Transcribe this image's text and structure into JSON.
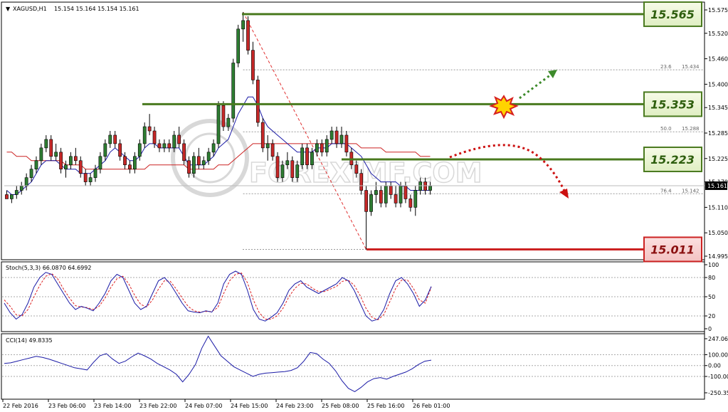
{
  "header": {
    "symbol_text": "XAGUSD,H1",
    "ohlc_text": "15.154 15.164 15.154 15.161"
  },
  "watermark": "FOREXIMF.COM",
  "levels": [
    {
      "label": "15.565",
      "value": 15.565,
      "kind": "resistance"
    },
    {
      "label": "15.353",
      "value": 15.353,
      "kind": "resistance"
    },
    {
      "label": "15.223",
      "value": 15.223,
      "kind": "resistance"
    },
    {
      "label": "15.011",
      "value": 15.011,
      "kind": "support"
    }
  ],
  "fib_levels": [
    {
      "ratio": "23.6",
      "price": "15.434",
      "value": 15.434
    },
    {
      "ratio": "50.0",
      "price": "15.288",
      "value": 15.288
    },
    {
      "ratio": "76.4",
      "price": "15.142",
      "value": 15.142
    }
  ],
  "current_price": "15.161",
  "colors": {
    "bull": "#2e7d32",
    "bear": "#c62828",
    "ma_fast": "#1a1aa6",
    "ma_slow": "#cc2222",
    "resistance": "#4a7a1f",
    "support": "#cc2222",
    "stoch_main": "#1a1aa6",
    "stoch_signal": "#dd2222",
    "cci": "#1a1aa6"
  },
  "chart_data": [
    {
      "type": "candlestick",
      "title": "XAGUSD,H1",
      "ylim": [
        14.995,
        15.585
      ],
      "yticks": [
        "15.575",
        "15.520",
        "15.460",
        "15.400",
        "15.345",
        "15.285",
        "15.225",
        "15.170",
        "15.110",
        "15.050",
        "14.995"
      ],
      "xlabels": [
        "22 Feb 2016",
        "23 Feb 06:00",
        "23 Feb 14:00",
        "23 Feb 22:00",
        "24 Feb 07:00",
        "24 Feb 15:00",
        "24 Feb 23:00",
        "25 Feb 08:00",
        "25 Feb 16:00",
        "26 Feb 01:00"
      ],
      "ohlc": [
        [
          15.14,
          15.15,
          15.13,
          15.13
        ],
        [
          15.13,
          15.14,
          15.12,
          15.14
        ],
        [
          15.14,
          15.16,
          15.13,
          15.15
        ],
        [
          15.15,
          15.17,
          15.14,
          15.16
        ],
        [
          15.16,
          15.19,
          15.15,
          15.18
        ],
        [
          15.18,
          15.21,
          15.17,
          15.2
        ],
        [
          15.2,
          15.23,
          15.19,
          15.22
        ],
        [
          15.22,
          15.26,
          15.21,
          15.25
        ],
        [
          15.25,
          15.28,
          15.24,
          15.27
        ],
        [
          15.27,
          15.28,
          15.22,
          15.23
        ],
        [
          15.23,
          15.26,
          15.22,
          15.24
        ],
        [
          15.24,
          15.25,
          15.19,
          15.2
        ],
        [
          15.2,
          15.22,
          15.18,
          15.21
        ],
        [
          15.21,
          15.24,
          15.2,
          15.23
        ],
        [
          15.23,
          15.25,
          15.21,
          15.22
        ],
        [
          15.22,
          15.23,
          15.18,
          15.19
        ],
        [
          15.19,
          15.2,
          15.16,
          15.17
        ],
        [
          15.17,
          15.19,
          15.16,
          15.18
        ],
        [
          15.18,
          15.21,
          15.17,
          15.2
        ],
        [
          15.2,
          15.24,
          15.19,
          15.23
        ],
        [
          15.23,
          15.27,
          15.22,
          15.26
        ],
        [
          15.26,
          15.29,
          15.25,
          15.28
        ],
        [
          15.28,
          15.29,
          15.25,
          15.26
        ],
        [
          15.26,
          15.27,
          15.22,
          15.23
        ],
        [
          15.23,
          15.24,
          15.2,
          15.21
        ],
        [
          15.21,
          15.22,
          15.19,
          15.2
        ],
        [
          15.2,
          15.24,
          15.19,
          15.23
        ],
        [
          15.23,
          15.27,
          15.22,
          15.26
        ],
        [
          15.26,
          15.31,
          15.25,
          15.3
        ],
        [
          15.3,
          15.33,
          15.28,
          15.29
        ],
        [
          15.29,
          15.3,
          15.25,
          15.26
        ],
        [
          15.26,
          15.27,
          15.24,
          15.25
        ],
        [
          15.25,
          15.27,
          15.24,
          15.26
        ],
        [
          15.26,
          15.27,
          15.24,
          15.25
        ],
        [
          15.25,
          15.29,
          15.24,
          15.28
        ],
        [
          15.28,
          15.3,
          15.25,
          15.26
        ],
        [
          15.26,
          15.27,
          15.21,
          15.22
        ],
        [
          15.22,
          15.23,
          15.18,
          15.19
        ],
        [
          15.19,
          15.24,
          15.18,
          15.23
        ],
        [
          15.23,
          15.25,
          15.2,
          15.21
        ],
        [
          15.21,
          15.23,
          15.2,
          15.22
        ],
        [
          15.22,
          15.25,
          15.21,
          15.24
        ],
        [
          15.24,
          15.27,
          15.23,
          15.26
        ],
        [
          15.26,
          15.36,
          15.25,
          15.35
        ],
        [
          15.35,
          15.36,
          15.29,
          15.3
        ],
        [
          15.3,
          15.33,
          15.29,
          15.32
        ],
        [
          15.32,
          15.46,
          15.31,
          15.45
        ],
        [
          15.45,
          15.54,
          15.44,
          15.53
        ],
        [
          15.53,
          15.57,
          15.5,
          15.55
        ],
        [
          15.55,
          15.56,
          15.47,
          15.48
        ],
        [
          15.48,
          15.5,
          15.4,
          15.41
        ],
        [
          15.41,
          15.42,
          15.3,
          15.31
        ],
        [
          15.31,
          15.32,
          15.24,
          15.25
        ],
        [
          15.25,
          15.28,
          15.22,
          15.26
        ],
        [
          15.26,
          15.27,
          15.22,
          15.23
        ],
        [
          15.23,
          15.24,
          15.17,
          15.18
        ],
        [
          15.18,
          15.22,
          15.17,
          15.21
        ],
        [
          15.21,
          15.24,
          15.2,
          15.22
        ],
        [
          15.22,
          15.23,
          15.17,
          15.18
        ],
        [
          15.18,
          15.22,
          15.17,
          15.21
        ],
        [
          15.21,
          15.26,
          15.2,
          15.25
        ],
        [
          15.25,
          15.26,
          15.2,
          15.21
        ],
        [
          15.21,
          15.25,
          15.2,
          15.24
        ],
        [
          15.24,
          15.27,
          15.23,
          15.26
        ],
        [
          15.26,
          15.27,
          15.23,
          15.24
        ],
        [
          15.24,
          15.28,
          15.23,
          15.27
        ],
        [
          15.27,
          15.3,
          15.26,
          15.29
        ],
        [
          15.29,
          15.3,
          15.25,
          15.26
        ],
        [
          15.26,
          15.3,
          15.25,
          15.28
        ],
        [
          15.28,
          15.29,
          15.23,
          15.24
        ],
        [
          15.24,
          15.25,
          15.2,
          15.21
        ],
        [
          15.21,
          15.22,
          15.18,
          15.19
        ],
        [
          15.19,
          15.2,
          15.14,
          15.15
        ],
        [
          15.15,
          15.16,
          15.011,
          15.1
        ],
        [
          15.1,
          15.15,
          15.09,
          15.14
        ],
        [
          15.14,
          15.17,
          15.12,
          15.15
        ],
        [
          15.15,
          15.16,
          15.11,
          15.12
        ],
        [
          15.12,
          15.17,
          15.11,
          15.16
        ],
        [
          15.16,
          15.17,
          15.13,
          15.14
        ],
        [
          15.14,
          15.16,
          15.11,
          15.12
        ],
        [
          15.12,
          15.17,
          15.11,
          15.16
        ],
        [
          15.16,
          15.17,
          15.12,
          15.13
        ],
        [
          15.13,
          15.14,
          15.1,
          15.11
        ],
        [
          15.11,
          15.16,
          15.09,
          15.15
        ],
        [
          15.15,
          15.18,
          15.14,
          15.17
        ],
        [
          15.17,
          15.18,
          15.14,
          15.15
        ],
        [
          15.15,
          15.17,
          15.14,
          15.16
        ]
      ],
      "ma_fast": [
        15.15,
        15.14,
        15.14,
        15.15,
        15.16,
        15.17,
        15.19,
        15.21,
        15.22,
        15.22,
        15.22,
        15.21,
        15.2,
        15.2,
        15.2,
        15.19,
        15.19,
        15.19,
        15.2,
        15.21,
        15.22,
        15.24,
        15.25,
        15.24,
        15.23,
        15.22,
        15.22,
        15.23,
        15.25,
        15.26,
        15.26,
        15.25,
        15.25,
        15.25,
        15.25,
        15.25,
        15.23,
        15.21,
        15.21,
        15.21,
        15.21,
        15.22,
        15.23,
        15.25,
        15.26,
        15.27,
        15.3,
        15.33,
        15.35,
        15.37,
        15.37,
        15.35,
        15.32,
        15.3,
        15.29,
        15.28,
        15.27,
        15.26,
        15.25,
        15.24,
        15.24,
        15.24,
        15.24,
        15.25,
        15.25,
        15.25,
        15.26,
        15.26,
        15.26,
        15.26,
        15.25,
        15.24,
        15.23,
        15.21,
        15.19,
        15.18,
        15.17,
        15.17,
        15.17,
        15.17,
        15.16,
        15.16,
        15.15,
        15.15,
        15.15,
        15.15,
        15.15
      ],
      "ma_slow": [
        15.24,
        15.24,
        15.23,
        15.23,
        15.23,
        15.22,
        15.22,
        15.22,
        15.22,
        15.22,
        15.22,
        15.22,
        15.21,
        15.21,
        15.21,
        15.21,
        15.2,
        15.2,
        15.2,
        15.2,
        15.2,
        15.2,
        15.2,
        15.2,
        15.2,
        15.2,
        15.2,
        15.2,
        15.2,
        15.21,
        15.21,
        15.21,
        15.21,
        15.21,
        15.21,
        15.21,
        15.21,
        15.2,
        15.2,
        15.2,
        15.2,
        15.2,
        15.2,
        15.21,
        15.21,
        15.21,
        15.22,
        15.23,
        15.24,
        15.25,
        15.26,
        15.26,
        15.26,
        15.26,
        15.26,
        15.26,
        15.26,
        15.26,
        15.26,
        15.26,
        15.26,
        15.26,
        15.26,
        15.26,
        15.26,
        15.26,
        15.26,
        15.26,
        15.26,
        15.26,
        15.26,
        15.26,
        15.25,
        15.25,
        15.25,
        15.25,
        15.25,
        15.24,
        15.24,
        15.24,
        15.24,
        15.24,
        15.24,
        15.24,
        15.23,
        15.23,
        15.23
      ]
    },
    {
      "type": "line",
      "title": "Stoch(5,3,3) 66.0870 64.6992",
      "ylim": [
        0,
        100
      ],
      "yticks": [
        "100",
        "80",
        "50",
        "20",
        "0"
      ],
      "series": [
        {
          "name": "main",
          "values": [
            40,
            25,
            15,
            22,
            40,
            65,
            80,
            88,
            85,
            70,
            55,
            40,
            30,
            35,
            32,
            28,
            40,
            55,
            75,
            85,
            80,
            60,
            40,
            30,
            35,
            55,
            75,
            80,
            70,
            55,
            40,
            28,
            26,
            25,
            28,
            26,
            40,
            70,
            85,
            90,
            85,
            60,
            30,
            15,
            12,
            18,
            25,
            40,
            60,
            70,
            75,
            65,
            60,
            55,
            60,
            65,
            70,
            80,
            75,
            60,
            40,
            20,
            12,
            15,
            30,
            55,
            75,
            80,
            70,
            55,
            35,
            45,
            66
          ]
        },
        {
          "name": "signal",
          "values": [
            45,
            35,
            22,
            20,
            30,
            50,
            68,
            82,
            86,
            78,
            62,
            48,
            36,
            34,
            33,
            30,
            35,
            48,
            65,
            78,
            82,
            70,
            52,
            38,
            34,
            45,
            62,
            75,
            74,
            62,
            48,
            35,
            28,
            26,
            27,
            27,
            33,
            55,
            75,
            85,
            87,
            72,
            45,
            25,
            15,
            15,
            20,
            32,
            50,
            63,
            71,
            70,
            63,
            58,
            58,
            62,
            66,
            74,
            76,
            68,
            52,
            32,
            18,
            14,
            22,
            42,
            63,
            76,
            76,
            63,
            45,
            40,
            64.7
          ]
        }
      ]
    },
    {
      "type": "line",
      "title": "CCI(14) 49.8335",
      "ylim": [
        -250.35,
        247.065
      ],
      "yticks": [
        "247.065",
        "100.00",
        "0.00",
        "-100.00",
        "-250.35"
      ],
      "series": [
        {
          "name": "CCI",
          "values": [
            20,
            25,
            40,
            55,
            70,
            85,
            75,
            60,
            40,
            20,
            0,
            -20,
            -30,
            -40,
            30,
            90,
            110,
            60,
            20,
            40,
            80,
            115,
            90,
            60,
            20,
            -10,
            -40,
            -80,
            -150,
            -80,
            10,
            160,
            270,
            180,
            90,
            40,
            -10,
            -40,
            -70,
            -100,
            -80,
            -70,
            -65,
            -60,
            -55,
            -45,
            -20,
            40,
            120,
            110,
            60,
            20,
            -50,
            -140,
            -210,
            -240,
            -200,
            -150,
            -120,
            -110,
            -125,
            -100,
            -80,
            -60,
            -30,
            10,
            40,
            50
          ]
        }
      ]
    }
  ]
}
